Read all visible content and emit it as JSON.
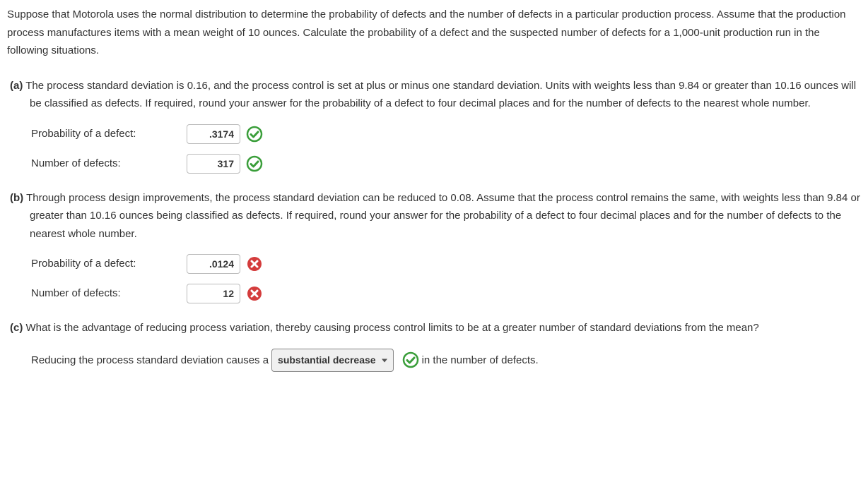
{
  "intro": "Suppose that Motorola uses the normal distribution to determine the probability of defects and the number of defects in a particular production process. Assume that the production process manufactures items with a mean weight of 10 ounces. Calculate the probability of a defect and the suspected number of defects for a 1,000-unit production run in the following situations.",
  "partA": {
    "label": "(a)",
    "text": "The process standard deviation is 0.16, and the process control is set at plus or minus one standard deviation. Units with weights less than 9.84 or greater than 10.16 ounces will be classified as defects. If required, round your answer for the probability of a defect to four decimal places and for the number of defects to the nearest whole number.",
    "prob_label": "Probability of a defect:",
    "prob_value": ".3174",
    "num_label": "Number of defects:",
    "num_value": "317"
  },
  "partB": {
    "label": "(b)",
    "text": "Through process design improvements, the process standard deviation can be reduced to 0.08. Assume that the process control remains the same, with weights less than 9.84 or greater than 10.16 ounces being classified as defects. If required, round your answer for the probability of a defect to four decimal places and for the number of defects to the nearest whole number.",
    "prob_label": "Probability of a defect:",
    "prob_value": ".0124",
    "num_label": "Number of defects:",
    "num_value": "12"
  },
  "partC": {
    "label": "(c)",
    "text": "What is the advantage of reducing process variation, thereby causing process control limits to be at a greater number of standard deviations from the mean?",
    "answer_prefix": "Reducing the process standard deviation causes a",
    "select_value": "substantial decrease",
    "answer_suffix": "in the number of defects."
  }
}
